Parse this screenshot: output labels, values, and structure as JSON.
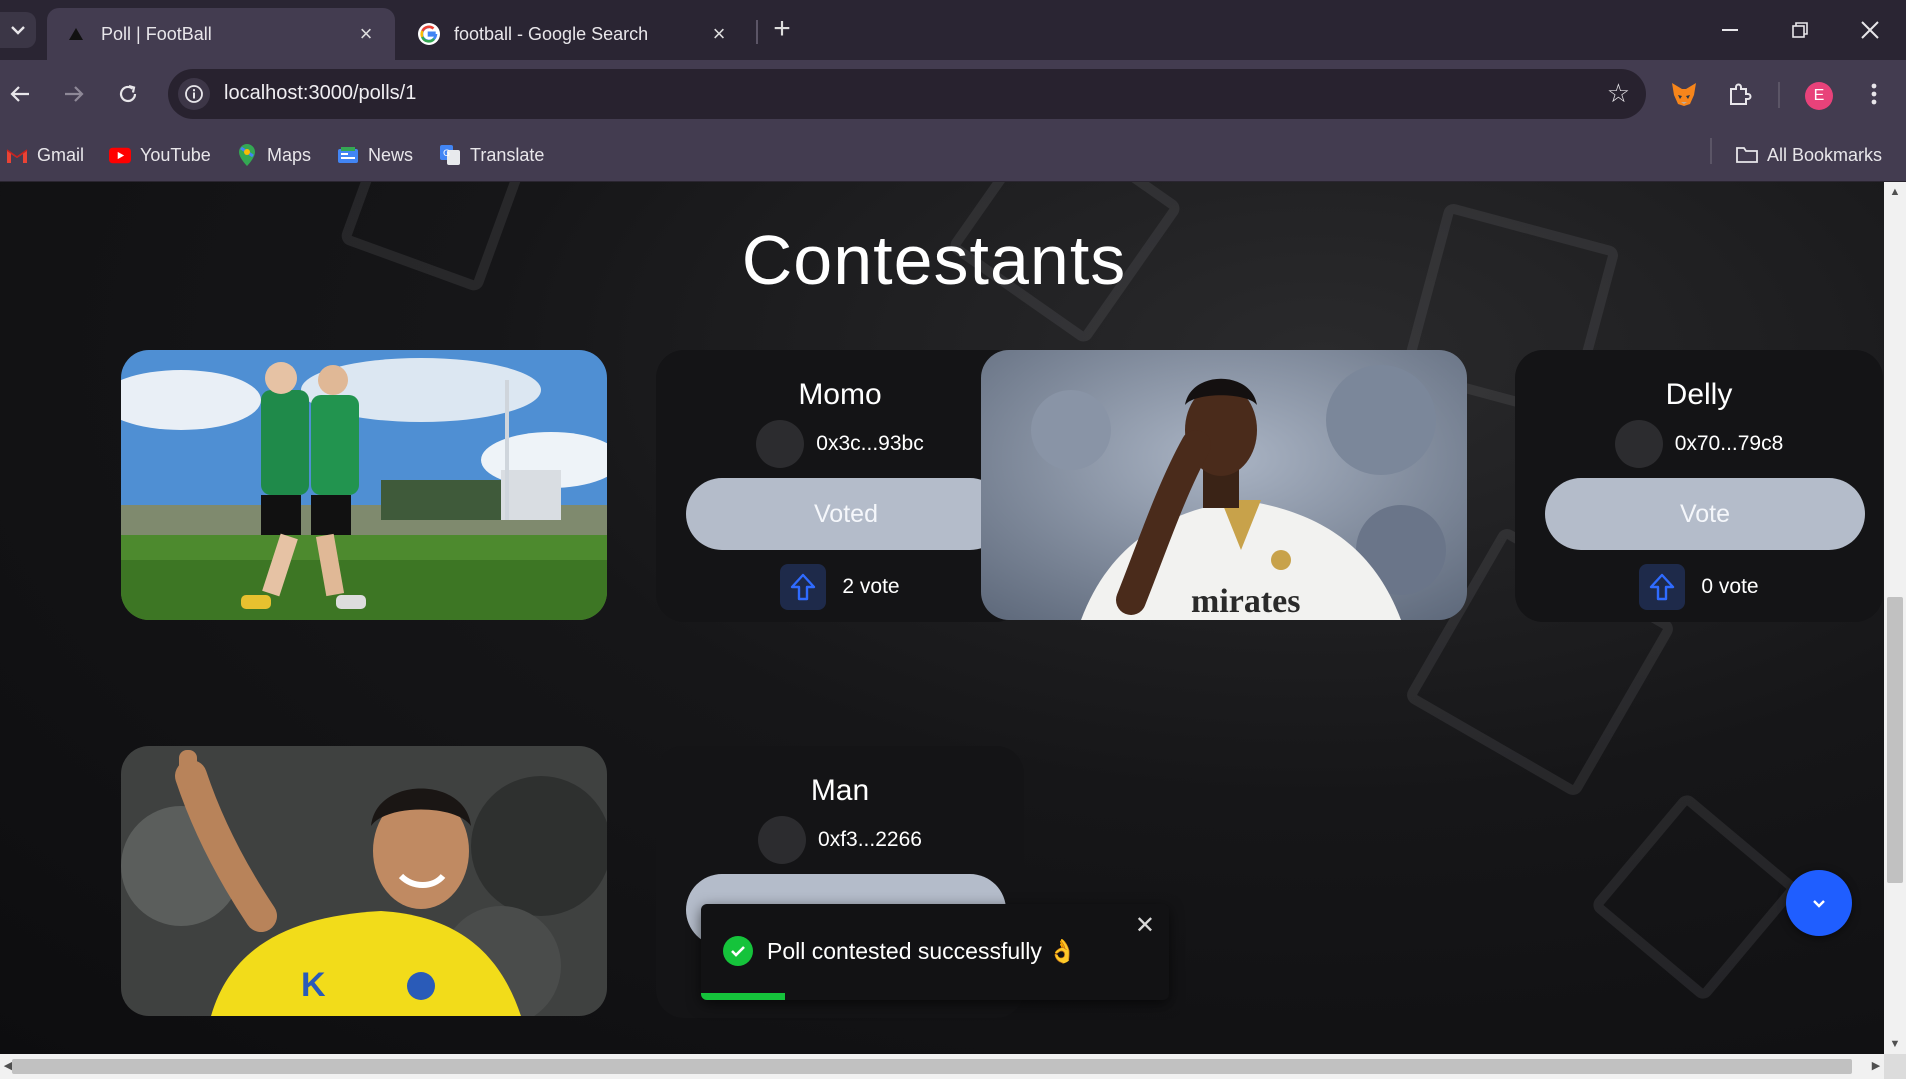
{
  "browser": {
    "tabs": [
      {
        "title": "Poll | FootBall",
        "active": true
      },
      {
        "title": "football - Google Search",
        "active": false
      }
    ],
    "url": "localhost:3000/polls/1",
    "profile_initial": "E",
    "bookmarks": [
      "Gmail",
      "YouTube",
      "Maps",
      "News",
      "Translate"
    ],
    "all_bookmarks_label": "All Bookmarks"
  },
  "page": {
    "heading": "Contestants",
    "contestants": [
      {
        "name": "Momo",
        "address": "0x3c...93bc",
        "button_label": "Voted",
        "votes_label": "2 vote"
      },
      {
        "name": "Delly",
        "address": "0x70...79c8",
        "button_label": "Vote",
        "votes_label": "0 vote"
      },
      {
        "name": "Man",
        "address": "0xf3...2266",
        "button_label": "",
        "votes_label": ""
      }
    ]
  },
  "toast": {
    "message": "Poll contested successfully 👌",
    "progress": 0.18,
    "color": "#15c33b"
  },
  "colors": {
    "accent": "#1f5eff",
    "vote_button": "#b4bcca"
  }
}
